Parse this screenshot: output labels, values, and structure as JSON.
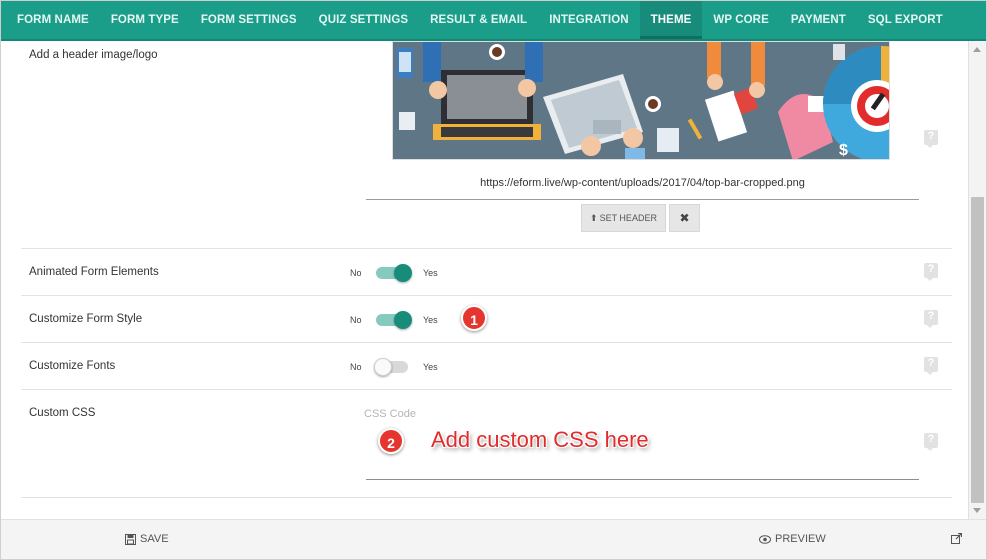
{
  "tabs": [
    {
      "label": "FORM NAME"
    },
    {
      "label": "FORM TYPE"
    },
    {
      "label": "FORM SETTINGS"
    },
    {
      "label": "QUIZ SETTINGS"
    },
    {
      "label": "RESULT & EMAIL"
    },
    {
      "label": "INTEGRATION"
    },
    {
      "label": "THEME"
    },
    {
      "label": "WP CORE"
    },
    {
      "label": "PAYMENT"
    },
    {
      "label": "SQL EXPORT"
    }
  ],
  "active_tab": "THEME",
  "header_image": {
    "label": "Add a header image/logo",
    "url": "https://eform.live/wp-content/uploads/2017/04/top-bar-cropped.png",
    "set_button": "SET HEADER",
    "remove_button": "✖"
  },
  "toggles": {
    "animated": {
      "label": "Animated Form Elements",
      "no": "No",
      "yes": "Yes",
      "value": true
    },
    "custom_style": {
      "label": "Customize Form Style",
      "no": "No",
      "yes": "Yes",
      "value": true
    },
    "custom_fonts": {
      "label": "Customize Fonts",
      "no": "No",
      "yes": "Yes",
      "value": false
    }
  },
  "custom_css": {
    "label": "Custom CSS",
    "placeholder": "CSS Code",
    "value": ""
  },
  "annotations": {
    "badge1": "1",
    "badge2": "2",
    "note": "Add custom CSS here"
  },
  "help_icon_glyph": "?",
  "footer": {
    "save": "SAVE",
    "preview": "PREVIEW"
  },
  "colors": {
    "accent": "#1a9e8a",
    "accent_dark": "#178c7a",
    "annotation_red": "#e4362f"
  }
}
